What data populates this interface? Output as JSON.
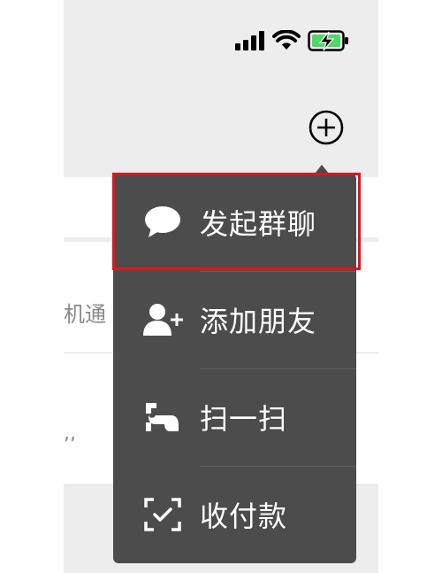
{
  "status_bar": {
    "icons": [
      "signal-icon",
      "wifi-icon",
      "battery-charging-icon"
    ],
    "battery_color": "#4cd964"
  },
  "header": {
    "add_icon": "plus-circle-icon"
  },
  "background_list": {
    "row_b_text": "机通",
    "row_c_text": ",,"
  },
  "menu": {
    "background_color": "#4c4c4c",
    "items": [
      {
        "label": "发起群聊",
        "icon": "chat-bubble-icon"
      },
      {
        "label": "添加朋友",
        "icon": "add-friend-icon"
      },
      {
        "label": "扫一扫",
        "icon": "scan-icon"
      },
      {
        "label": "收付款",
        "icon": "payment-icon"
      }
    ]
  },
  "annotation": {
    "highlight_color": "#e0141c"
  }
}
